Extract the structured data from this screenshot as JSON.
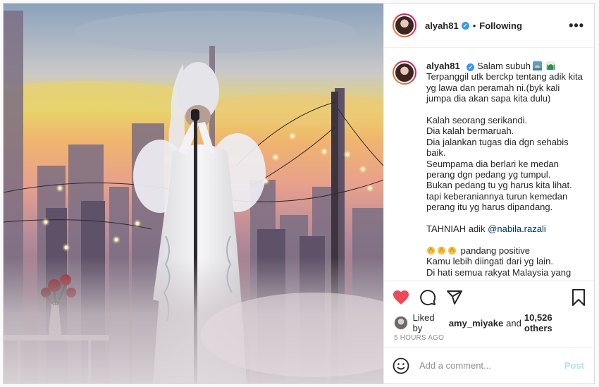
{
  "post": {
    "username": "alyah81",
    "separator": "•",
    "follow_status": "Following",
    "more_label": "•••",
    "caption": {
      "username": "alyah81",
      "first_line": "Salam subuh",
      "lines": [
        "Terpanggil utk berckp tentang adik kita yg lawa dan peramah ni.(byk kali jumpa dia akan sapa kita dulu)",
        "",
        "Kalah seorang serikandi.",
        "Dia kalah bermaruah.",
        "Dia jalankan tugas dia dgn sehabis baik.",
        "Seumpama dia berlari ke medan perang dgn pedang yg tumpul.",
        "Bukan pedang tu yg harus kita lihat. tapi keberaniannya turun kemedan perang itu yg harus dipandang.",
        ""
      ],
      "congrats_prefix": "TAHNIAH adik ",
      "mention": "@nabila.razali",
      "positive_text": "pandang positive",
      "last_line": "Kamu lebih diingati dari yg lain.",
      "cut_line": "Di hati semua rakyat Malaysia yang menontonmu"
    },
    "likes": {
      "prefix": "Liked by",
      "liker": "amy_miyake",
      "conj": "and",
      "others": "10,526 others"
    },
    "time_ago": "5 HOURS AGO",
    "comment": {
      "placeholder": "Add a comment...",
      "post_label": "Post"
    },
    "icons": {
      "heart": "heart-filled-icon",
      "comment": "comment-icon",
      "share": "share-icon",
      "save": "bookmark-icon",
      "emoji": "smiley-icon",
      "verified": "verified-badge-icon"
    },
    "colors": {
      "heart": "#ed4956",
      "verified": "#3897f0",
      "mention": "#00376b",
      "post_disabled": "#b2dffc",
      "meta": "#8e8e8e"
    }
  }
}
